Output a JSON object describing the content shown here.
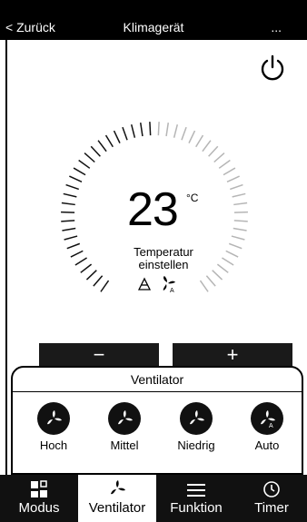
{
  "header": {
    "back": "< Zurück",
    "title": "Klimagerät",
    "more": "..."
  },
  "temperature": {
    "value": "23",
    "unit": "°C",
    "label_line1": "Temperatur",
    "label_line2": "einstellen"
  },
  "controls": {
    "minus": "−",
    "plus": "+"
  },
  "fan_panel": {
    "title": "Ventilator",
    "speeds": [
      {
        "label": "Hoch"
      },
      {
        "label": "Mittel"
      },
      {
        "label": "Niedrig"
      },
      {
        "label": "Auto"
      }
    ]
  },
  "tabs": [
    {
      "label": "Modus",
      "icon": "grid-icon"
    },
    {
      "label": "Ventilator",
      "icon": "fan-icon"
    },
    {
      "label": "Funktion",
      "icon": "menu-icon"
    },
    {
      "label": "Timer",
      "icon": "clock-icon"
    }
  ],
  "active_tab": "Ventilator"
}
